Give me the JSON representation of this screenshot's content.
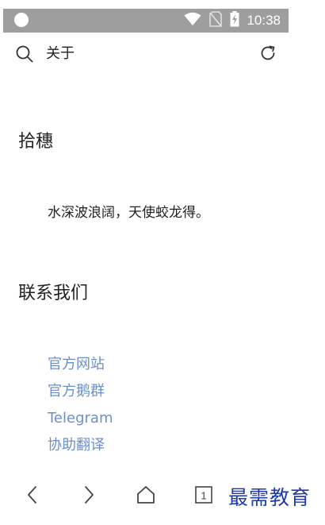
{
  "status_bar": {
    "time": "10:38",
    "icons": [
      "wifi-icon",
      "no-sim-icon",
      "battery-charging-icon"
    ]
  },
  "toolbar": {
    "title": "关于",
    "icons": [
      "search-icon",
      "refresh-icon"
    ]
  },
  "section_about": {
    "heading": "拾穗",
    "text": "水深波浪阔，天使蛟龙得。"
  },
  "section_contact": {
    "heading": "联系我们",
    "links": [
      "官方网站",
      "官方鹅群",
      "Telegram",
      "协助翻译"
    ]
  },
  "bottom_nav": {
    "icons": [
      "back-icon",
      "forward-icon",
      "home-icon",
      "tabs-icon"
    ],
    "tab_count": "1"
  },
  "watermark": "最需教育",
  "colors": {
    "link": "#6b8fc9",
    "status_bar": "#9e9e9e",
    "watermark": "#1f3aa8"
  }
}
